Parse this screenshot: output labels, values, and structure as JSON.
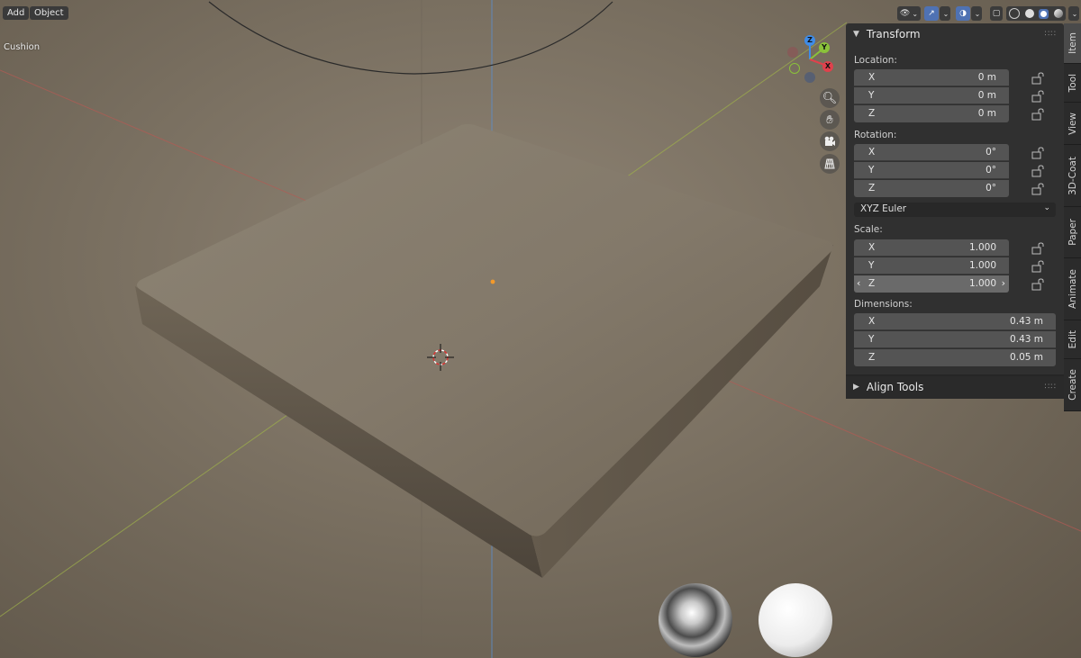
{
  "header": {
    "add_label": "Add",
    "object_label": "Object"
  },
  "viewport": {
    "object_name": "Cushion"
  },
  "gizmo": {
    "z_label": "Z",
    "y_label": "Y",
    "x_label": "X"
  },
  "nav_icons": [
    "zoom-icon",
    "hand-pan-icon",
    "camera-icon",
    "grid-ortho-icon"
  ],
  "transform_panel": {
    "title": "Transform",
    "location": {
      "label": "Location:",
      "x_axis": "X",
      "x": "0 m",
      "y_axis": "Y",
      "y": "0 m",
      "z_axis": "Z",
      "z": "0 m"
    },
    "rotation": {
      "label": "Rotation:",
      "x_axis": "X",
      "x": "0°",
      "y_axis": "Y",
      "y": "0°",
      "z_axis": "Z",
      "z": "0°",
      "mode": "XYZ Euler"
    },
    "scale": {
      "label": "Scale:",
      "x_axis": "X",
      "x": "1.000",
      "y_axis": "Y",
      "y": "1.000",
      "z_axis": "Z",
      "z": "1.000"
    },
    "dimensions": {
      "label": "Dimensions:",
      "x_axis": "X",
      "x": "0.43 m",
      "y_axis": "Y",
      "y": "0.43 m",
      "z_axis": "Z",
      "z": "0.05 m"
    }
  },
  "align_tools_panel": {
    "title": "Align Tools"
  },
  "side_tabs": [
    "Item",
    "Tool",
    "View",
    "3D-Coat",
    "Paper",
    "Animate",
    "Edit",
    "Create"
  ],
  "colors": {
    "accent": "#4f72b3",
    "axis_x": "#e0414c",
    "axis_y": "#8ac23a",
    "axis_z": "#3e8ce8"
  }
}
